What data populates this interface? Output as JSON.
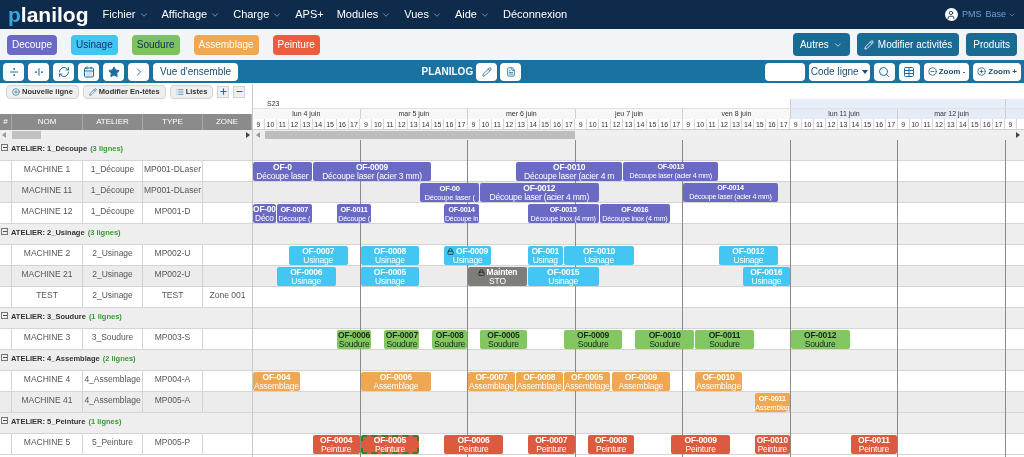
{
  "app": {
    "logo": "planilog",
    "user": "PMS",
    "user_menu": "Base"
  },
  "menu": [
    {
      "label": "Fichier",
      "dropdown": true
    },
    {
      "label": "Affichage",
      "dropdown": true
    },
    {
      "label": "Charge",
      "dropdown": true
    },
    {
      "label": "APS+",
      "dropdown": false
    },
    {
      "label": "Modules",
      "dropdown": true
    },
    {
      "label": "Vues",
      "dropdown": true
    },
    {
      "label": "Aide",
      "dropdown": true
    },
    {
      "label": "Déconnexion",
      "dropdown": false
    }
  ],
  "atelier_buttons": [
    {
      "label": "Decoupe",
      "color": "#6a6ac6",
      "dark_text": false
    },
    {
      "label": "Usinage",
      "color": "#3fc7f2",
      "dark_text": true
    },
    {
      "label": "Soudure",
      "color": "#7cc35d",
      "dark_text": true
    },
    {
      "label": "Assemblage",
      "color": "#f3a650",
      "dark_text": false
    },
    {
      "label": "Peinture",
      "color": "#ee5b3d",
      "dark_text": false
    }
  ],
  "right_buttons": [
    {
      "label": "Autres",
      "kind": "dropdown"
    },
    {
      "label": "Modifier activités",
      "kind": "edit"
    },
    {
      "label": "Produits",
      "kind": "plain"
    }
  ],
  "toolbar": {
    "overview": "Vue d'ensemble",
    "title": "PLANILOG",
    "code_select": "Code ligne",
    "zoom_out": "Zoom -",
    "zoom_in": "Zoom +"
  },
  "table_actions": [
    {
      "label": "Nouvelle ligne",
      "kind": "add"
    },
    {
      "label": "Modifier En-têtes",
      "kind": "edit"
    },
    {
      "label": "Listes",
      "kind": "list"
    }
  ],
  "columns": [
    "#",
    "NOM",
    "ATELIER",
    "TYPE",
    "ZONE"
  ],
  "weeks": [
    {
      "label": "S23",
      "days": [
        {
          "label": "lun 4 juin",
          "hours": [
            "9",
            "10",
            "11",
            "12",
            "13",
            "14",
            "15",
            "16",
            "17"
          ]
        },
        {
          "label": "mar 5 juin",
          "hours": [
            "9",
            "10",
            "11",
            "12",
            "13",
            "14",
            "15",
            "16",
            "17"
          ]
        },
        {
          "label": "mer 6 juin",
          "hours": [
            "9",
            "10",
            "11",
            "12",
            "13",
            "14",
            "15",
            "16",
            "17"
          ]
        },
        {
          "label": "jeu 7 juin",
          "hours": [
            "9",
            "10",
            "11",
            "12",
            "13",
            "14",
            "15",
            "16",
            "17"
          ]
        },
        {
          "label": "ven 8 juin",
          "hours": [
            "9",
            "10",
            "11",
            "12",
            "13",
            "14",
            "15",
            "16",
            "17"
          ]
        }
      ]
    },
    {
      "days": [
        {
          "label": "lun 11 juin",
          "hours": [
            "9",
            "10",
            "11",
            "12",
            "13",
            "14",
            "15",
            "16",
            "17"
          ]
        },
        {
          "label": "mar 12 juin",
          "hours": [
            "9",
            "10",
            "11",
            "12",
            "13",
            "14",
            "15",
            "16",
            "17"
          ]
        }
      ]
    }
  ],
  "trailing_hours": [
    "9"
  ],
  "groups": [
    {
      "title": "ATELIER: 1_Découpe",
      "count": "(3 lignes)",
      "expanded": true,
      "color": "#6a6ac4",
      "dark_text": false,
      "rows": [
        {
          "nom": "MACHINE 1",
          "atelier": "1_Découpe",
          "type": "MP001-DLaser",
          "bars": [
            {
              "code": "OF-0",
              "label": "Découpe laser",
              "kind": "order",
              "locked": false,
              "selected": false
            },
            {
              "code": "OF-0009",
              "label": "Découpe laser (acier 3 mm)",
              "kind": "order",
              "locked": false,
              "selected": false
            },
            {
              "code": "OF-0010",
              "label": "Découpe laser (acier 4 m",
              "kind": "order",
              "locked": false,
              "selected": false
            },
            {
              "code": "OF-0013",
              "label": "Découpe laser (acier 4 mm)",
              "kind": "order",
              "locked": false,
              "selected": false
            }
          ]
        },
        {
          "nom": "MACHINE 11",
          "atelier": "1_Découpe",
          "type": "MP001-DLaser",
          "bars": [
            {
              "code": "OF-00",
              "label": "Découpe laser (",
              "kind": "order",
              "locked": false,
              "selected": false
            },
            {
              "code": "OF-0012",
              "label": "Découpe laser (acier 4 mm)",
              "kind": "order",
              "locked": false,
              "selected": false
            },
            {
              "code": "OF-0014",
              "label": "Découpe laser (acier 4 mm)",
              "kind": "order",
              "locked": false,
              "selected": false
            }
          ]
        },
        {
          "nom": "MACHINE 12",
          "atelier": "1_Découpe",
          "type": "MP001-D",
          "bars": [
            {
              "code": "OF-00",
              "label": "Déco",
              "kind": "order",
              "locked": false,
              "selected": false
            },
            {
              "code": "OF-0007",
              "label": "Découpe (",
              "kind": "order",
              "locked": false,
              "selected": false
            },
            {
              "code": "OF-0011",
              "label": "Découpe (",
              "kind": "order",
              "locked": false,
              "selected": false
            },
            {
              "code": "OF-0014",
              "label": "Découpe in",
              "kind": "order",
              "locked": false,
              "selected": false
            },
            {
              "code": "OF-0015",
              "label": "Découpe inox (4 mm)",
              "kind": "order",
              "locked": false,
              "selected": false
            },
            {
              "code": "OF-0016",
              "label": "Découpe inox (4 mm)",
              "kind": "order",
              "locked": false,
              "selected": false
            }
          ]
        }
      ]
    },
    {
      "title": "ATELIER: 2_Usinage",
      "count": "(3 lignes)",
      "expanded": true,
      "color": "#44c6f3",
      "dark_text": false,
      "rows": [
        {
          "nom": "MACHINE 2",
          "atelier": "2_Usinage",
          "type": "MP002-U",
          "bars": [
            {
              "code": "OF-0007",
              "label": "Usinage",
              "kind": "order",
              "locked": false,
              "selected": false
            },
            {
              "code": "OF-0008",
              "label": "Usinage",
              "kind": "order",
              "locked": false,
              "selected": false
            },
            {
              "code": "OF-0009",
              "label": "Usinage",
              "kind": "order",
              "locked": true,
              "selected": false
            },
            {
              "code": "OF-001",
              "label": "Usinag",
              "kind": "order",
              "locked": false,
              "selected": false
            },
            {
              "code": "OF-0010",
              "label": "Usinage",
              "kind": "order",
              "locked": false,
              "selected": false
            },
            {
              "code": "OF-0012",
              "label": "Usinage",
              "kind": "order",
              "locked": false,
              "selected": false
            }
          ]
        },
        {
          "nom": "MACHINE 21",
          "atelier": "2_Usinage",
          "type": "MP002-U",
          "bars": [
            {
              "code": "OF-0006",
              "label": "Usinage",
              "kind": "order",
              "locked": false,
              "selected": false
            },
            {
              "code": "OF-0005",
              "label": "Usinage",
              "kind": "order",
              "locked": false,
              "selected": false
            },
            {
              "code": "Mainten",
              "label": "STO",
              "kind": "maintenance",
              "locked": true,
              "selected": false
            },
            {
              "code": "OF-0015",
              "label": "Usinage",
              "kind": "order",
              "locked": false,
              "selected": false
            },
            {
              "code": "OF-0016",
              "label": "Usinage",
              "kind": "order",
              "locked": false,
              "selected": false
            }
          ]
        },
        {
          "nom": "TEST",
          "atelier": "2_Usinage",
          "type": "TEST",
          "zone": "Zone 001",
          "bars": []
        }
      ]
    },
    {
      "title": "ATELIER: 3_Soudure",
      "count": "(1 lignes)",
      "expanded": true,
      "color": "#82c762",
      "dark_text": true,
      "rows": [
        {
          "nom": "MACHINE 3",
          "atelier": "3_Soudure",
          "type": "MP003-S",
          "bars": [
            {
              "code": "OF-0006",
              "label": "Soudure",
              "kind": "order",
              "locked": false,
              "selected": false
            },
            {
              "code": "OF-0007",
              "label": "Soudure",
              "kind": "order",
              "locked": false,
              "selected": false
            },
            {
              "code": "OF-008",
              "label": "Soudure",
              "kind": "order",
              "locked": false,
              "selected": false
            },
            {
              "code": "OF-0005",
              "label": "Soudure",
              "kind": "order",
              "locked": false,
              "selected": false
            },
            {
              "code": "OF-0009",
              "label": "Soudure",
              "kind": "order",
              "locked": false,
              "selected": false
            },
            {
              "code": "OF-0010",
              "label": "Soudure",
              "kind": "order",
              "locked": false,
              "selected": false
            },
            {
              "code": "OF-0011",
              "label": "Soudure",
              "kind": "order",
              "locked": false,
              "selected": false
            },
            {
              "code": "OF-0012",
              "label": "Soudure",
              "kind": "order",
              "locked": false,
              "selected": false
            }
          ]
        }
      ]
    },
    {
      "title": "ATELIER: 4_Assemblage",
      "count": "(2 lignes)",
      "expanded": true,
      "color": "#efa751",
      "dark_text": false,
      "rows": [
        {
          "nom": "MACHINE 4",
          "atelier": "4_Assemblage",
          "type": "MP004-A",
          "bars": [
            {
              "code": "OF-004",
              "label": "Assemblage",
              "kind": "order",
              "locked": false,
              "selected": false
            },
            {
              "code": "OF-0006",
              "label": "Assemblage",
              "kind": "order",
              "locked": false,
              "selected": false
            },
            {
              "code": "OF-0007",
              "label": "Assemblage",
              "kind": "order",
              "locked": false,
              "selected": false
            },
            {
              "code": "OF-0008",
              "label": "Assemblage",
              "kind": "order",
              "locked": false,
              "selected": false
            },
            {
              "code": "OF-0005",
              "label": "Assemblage",
              "kind": "order",
              "locked": false,
              "selected": false
            },
            {
              "code": "OF-0009",
              "label": "Assemblage",
              "kind": "order",
              "locked": false,
              "selected": false
            },
            {
              "code": "OF-0010",
              "label": "Assemblage",
              "kind": "order",
              "locked": false,
              "selected": false
            }
          ]
        },
        {
          "nom": "MACHINE 41",
          "atelier": "4_Assemblage",
          "type": "MP005-A",
          "bars": [
            {
              "code": "OF-0011",
              "label": "Assemblag",
              "kind": "order",
              "locked": false,
              "selected": false
            }
          ]
        }
      ]
    },
    {
      "title": "ATELIER: 5_Peinture",
      "count": "(1 lignes)",
      "expanded": true,
      "color": "#dc5a3f",
      "dark_text": false,
      "rows": [
        {
          "nom": "MACHINE 5",
          "atelier": "5_Peinture",
          "type": "MP005-P",
          "bars": [
            {
              "code": "OF-0004",
              "label": "Peinture",
              "kind": "order",
              "locked": false,
              "selected": false
            },
            {
              "code": "OF-0005",
              "label": "Peinture",
              "kind": "order",
              "locked": false,
              "selected": true
            },
            {
              "code": "OF-0006",
              "label": "Peinture",
              "kind": "order",
              "locked": false,
              "selected": false
            },
            {
              "code": "OF-0007",
              "label": "Peinture",
              "kind": "order",
              "locked": false,
              "selected": false
            },
            {
              "code": "OF-0008",
              "label": "Peinture",
              "kind": "order",
              "locked": false,
              "selected": false
            },
            {
              "code": "OF-0009",
              "label": "Peinture",
              "kind": "order",
              "locked": false,
              "selected": false
            },
            {
              "code": "OF-0010",
              "label": "Peinture",
              "kind": "order",
              "locked": false,
              "selected": false
            },
            {
              "code": "OF-0011",
              "label": "Peinture",
              "kind": "order",
              "locked": false,
              "selected": false
            }
          ]
        }
      ]
    }
  ]
}
